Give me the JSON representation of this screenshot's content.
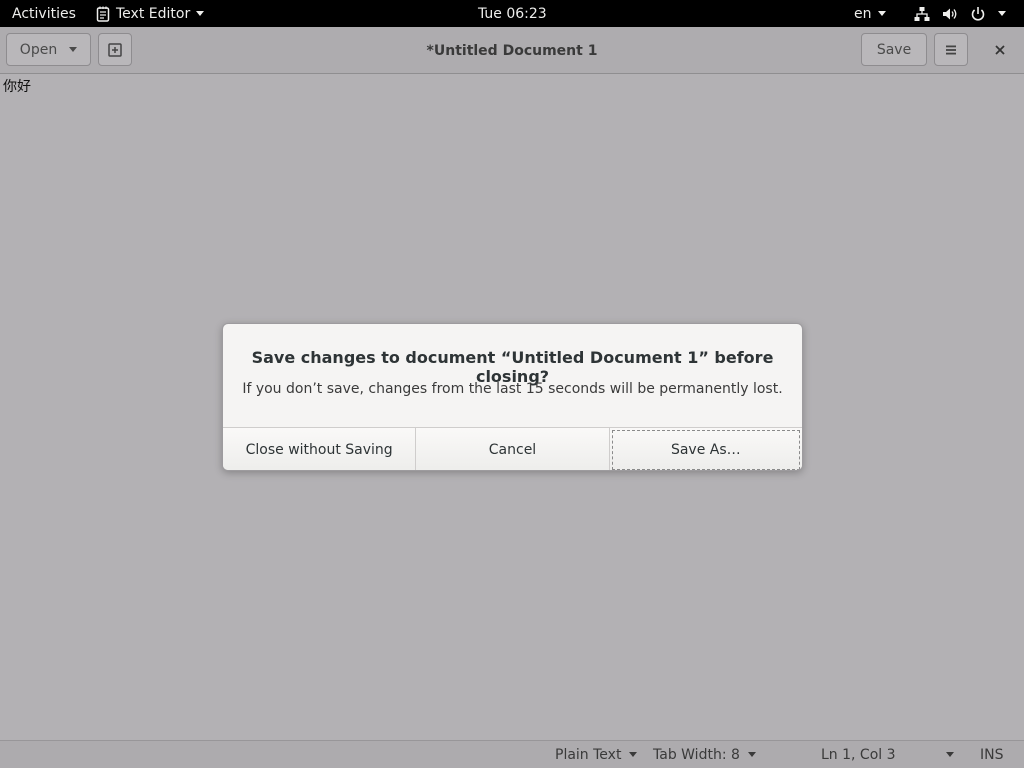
{
  "topbar": {
    "activities": "Activities",
    "app_name": "Text Editor",
    "clock": "Tue 06:23",
    "language": "en"
  },
  "headerbar": {
    "open_label": "Open",
    "title": "*Untitled Document 1",
    "save_label": "Save"
  },
  "editor": {
    "content": "你好"
  },
  "statusbar": {
    "language_mode": "Plain Text",
    "tab_width": "Tab Width: 8",
    "cursor_position": "Ln 1, Col 3",
    "insert_mode": "INS"
  },
  "dialog": {
    "title": "Save changes to document “Untitled Document 1” before closing?",
    "message": "If you don’t save, changes from the last 15 seconds will be permanently lost.",
    "buttons": {
      "close_without_saving": "Close without Saving",
      "cancel": "Cancel",
      "save_as": "Save As…"
    }
  }
}
